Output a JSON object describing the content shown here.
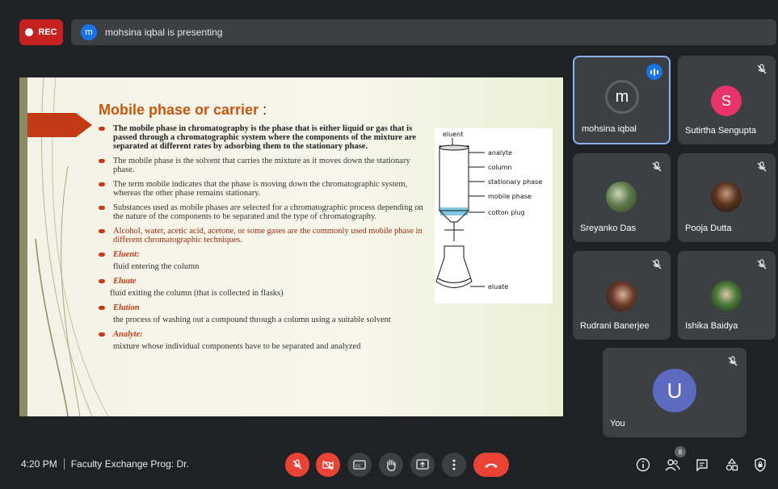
{
  "recording": {
    "label": "REC"
  },
  "presenter_bar": {
    "avatar_letter": "m",
    "text": "mohsina iqbal is presenting"
  },
  "slide": {
    "title": "Mobile phase or carrier",
    "title_colon": ":",
    "bullets": [
      "The mobile phase in chromatography is the phase that is either liquid or gas that is passed through a chromatographic system where the components of the mixture are separated at different rates by adsorbing them to the stationary phase.",
      "The mobile phase is the solvent that carries the mixture as it moves down the stationary phase.",
      "The term mobile indicates that the phase is moving down the chromatographic system, whereas the other phase remains stationary.",
      "Substances used as mobile phases are selected for a chromatographic process depending on the nature of the components to be separated and the type of chromatography.",
      "Alcohol, water, acetic acid, acetone, or some gases are the commonly used mobile phase in different chromatographic techniques."
    ],
    "terms": [
      {
        "term": "Eluent:",
        "definition": "fluid entering the column"
      },
      {
        "term": "Eluate",
        "definition": "fluid exiting the column (that is collected in flasks)"
      },
      {
        "term": "Elution",
        "definition": "the process of washing out a compound through a column using a suitable solvent"
      },
      {
        "term": "Analyte:",
        "definition": "mixture whose individual components have to be separated and analyzed"
      }
    ],
    "diagram_labels": {
      "eluent": "eluent",
      "analyte": "analyte",
      "column": "column",
      "stationary": "stationary phase",
      "mobile": "mobile phase",
      "cotton": "cotton plug",
      "eluate": "eluate"
    }
  },
  "participants": [
    {
      "name": "mohsina iqbal",
      "avatar_letter": "m",
      "avatar_color": "#3c4043",
      "speaking": true
    },
    {
      "name": "Sutirtha Sengupta",
      "avatar_letter": "S",
      "avatar_color": "#e8336b",
      "muted": true
    },
    {
      "name": "Sreyanko Das",
      "muted": true,
      "photo": "plant"
    },
    {
      "name": "Pooja Dutta",
      "muted": true,
      "photo": "person"
    },
    {
      "name": "Rudrani Banerjee",
      "muted": true,
      "photo": "person"
    },
    {
      "name": "Ishika Baidya",
      "muted": true,
      "photo": "person"
    },
    {
      "name": "You",
      "avatar_letter": "U",
      "avatar_color": "#5c6bc0",
      "muted": true
    }
  ],
  "bottom_bar": {
    "time": "4:20 PM",
    "meeting_title": "Faculty Exchange Prog: Dr.",
    "participant_count": "8"
  },
  "colors": {
    "accent_red": "#ea4335",
    "tile_bg": "#3c4043",
    "bg": "#202124",
    "slide_orange": "#c8570e"
  }
}
